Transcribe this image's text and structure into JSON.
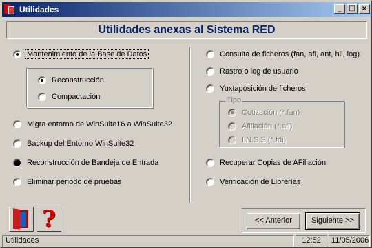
{
  "window": {
    "title": "Utilidades"
  },
  "header": {
    "title": "Utilidades anexas al Sistema RED"
  },
  "left_options": [
    {
      "label": "Mantenimiento de la Base de Datos",
      "checked": true
    },
    {
      "label": "Migra entorno de WinSuite16 a WinSuite32",
      "checked": false
    },
    {
      "label": "Backup del Entorno WinSuite32",
      "checked": false
    },
    {
      "label": "Reconstrucción de Bandeja de Entrada",
      "checked": false
    },
    {
      "label": "Eliminar periodo de pruebas",
      "checked": false
    }
  ],
  "maintenance_suboptions": [
    {
      "label": "Reconstrucción",
      "checked": true
    },
    {
      "label": "Compactación",
      "checked": false
    }
  ],
  "right_options": [
    {
      "label": "Consulta de ficheros (fan, afi, ant, hll, log)",
      "checked": false
    },
    {
      "label": "Rastro o log de usuario",
      "checked": false
    },
    {
      "label": "Yuxtaposición de ficheros",
      "checked": false
    },
    {
      "label": "Recuperar Copias de AFiliación",
      "checked": false
    },
    {
      "label": "Verificación de Librerías",
      "checked": false
    }
  ],
  "tipo_group": {
    "label": "Tipo",
    "options": [
      {
        "label": "Cotización (*.fan)",
        "checked": true,
        "disabled": true
      },
      {
        "label": "Afiliación (*.afi)",
        "checked": false,
        "disabled": true
      },
      {
        "label": "I.N.S.S.(*.fdi)",
        "checked": false,
        "disabled": true
      }
    ]
  },
  "buttons": {
    "back": "<< Anterior",
    "next": "Siguiente >>"
  },
  "icons": {
    "exit": "exit-door-icon",
    "help": "help-question-icon"
  },
  "statusbar": {
    "text": "Utilidades",
    "time": "12:52",
    "date": "11/05/2006"
  },
  "colors": {
    "title_gradient_start": "#0a246a",
    "title_gradient_end": "#a6caf0",
    "header_text": "#0a246a",
    "face": "#d4d0c8"
  }
}
